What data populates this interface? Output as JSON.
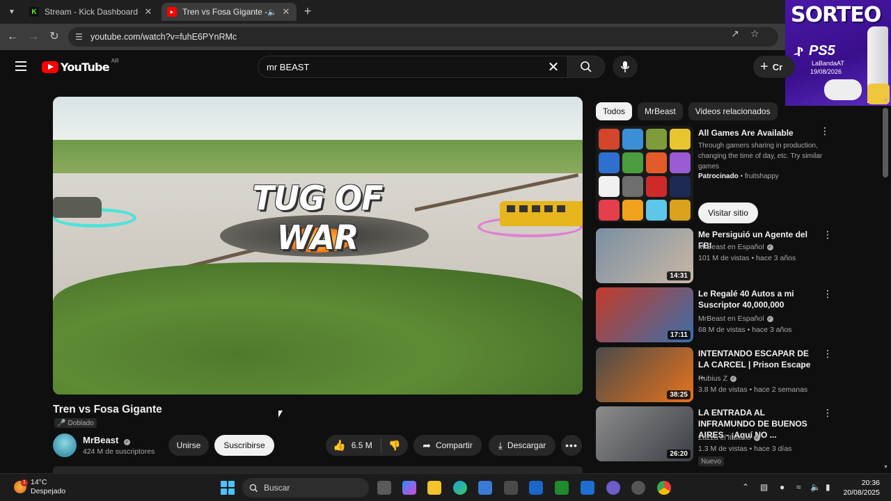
{
  "browser": {
    "tabs": [
      {
        "title": "Stream - Kick Dashboard",
        "favicon": "kick-icon"
      },
      {
        "title": "Tren vs Fosa Gigante - YouT",
        "favicon": "youtube-icon",
        "active": true
      }
    ],
    "url": "youtube.com/watch?v=fuhE6PYnRMc",
    "favicon_letter": "K"
  },
  "overlay": {
    "title": "SORTEO",
    "brand": "PS5",
    "line1": "LaBandaAT",
    "line2": "19/08/2026"
  },
  "header": {
    "logo_text": "YouTube",
    "country": "AR",
    "search_value": "mr BEAST",
    "create_label": "Cr"
  },
  "video": {
    "overlay_text": "TUG OF WAR",
    "title": "Tren vs Fosa Gigante",
    "badge": "Doblado",
    "channel": "MrBeast",
    "subscribers": "424 M de suscriptores",
    "join_label": "Unirse",
    "subscribe_label": "Suscribirse",
    "likes": "6.5 M",
    "share_label": "Compartir",
    "download_label": "Descargar"
  },
  "chips": [
    "Todos",
    "MrBeast",
    "Videos relacionados"
  ],
  "ad": {
    "title": "All Games Are Available",
    "description": "Through gamers sharing in production, changing the time of day, etc. Try similar games",
    "sponsored_label": "Patrocinado",
    "advertiser": "fruitshappy",
    "cta": "Visitar sitio",
    "tile_colors": [
      "#d2462b",
      "#3b8fd6",
      "#7e9c3a",
      "#e8c52f",
      "#2f6fd0",
      "#4b9d3f",
      "#e35b2a",
      "#9a5bd4",
      "#f1f1f1",
      "#6e6e6e",
      "#cf2a2a",
      "#1c2a55",
      "#e43f4a",
      "#f0a21c",
      "#5ec6e8",
      "#d9a21f"
    ]
  },
  "recommendations": [
    {
      "title": "Me Persiguió un Agente del FBI",
      "channel": "MrBeast en Español",
      "meta": "101 M de vistas • hace 3 años",
      "duration": "14:31",
      "colors": [
        "#7a8fa3",
        "#c9b7a4"
      ]
    },
    {
      "title": "Le Regalé 40 Autos a mi Suscriptor 40,000,000",
      "channel": "MrBeast en Español",
      "meta": "68 M de vistas • hace 3 años",
      "duration": "17:11",
      "colors": [
        "#c43b2a",
        "#3a6fa8"
      ]
    },
    {
      "title": "INTENTANDO ESCAPAR DE LA CARCEL | Prison Escape ...",
      "channel": "Rubius Z",
      "meta": "3.8 M de vistas • hace 2 semanas",
      "duration": "38:25",
      "colors": [
        "#4a4a4a",
        "#e8731c"
      ]
    },
    {
      "title": "LA ENTRADA AL INFRAMUNDO DE BUENOS AIRES - ¡Aquí NO ...",
      "channel": "Zazza el italiano",
      "meta": "1.3 M de vistas • hace 3 días",
      "duration": "26:20",
      "badge": "Nuevo",
      "colors": [
        "#8c8c8c",
        "#3b3f46"
      ]
    }
  ],
  "taskbar": {
    "temperature": "14°C",
    "condition": "Despejado",
    "notification_count": "1",
    "search_label": "Buscar",
    "time": "20:36",
    "date": "20/08/2025"
  }
}
